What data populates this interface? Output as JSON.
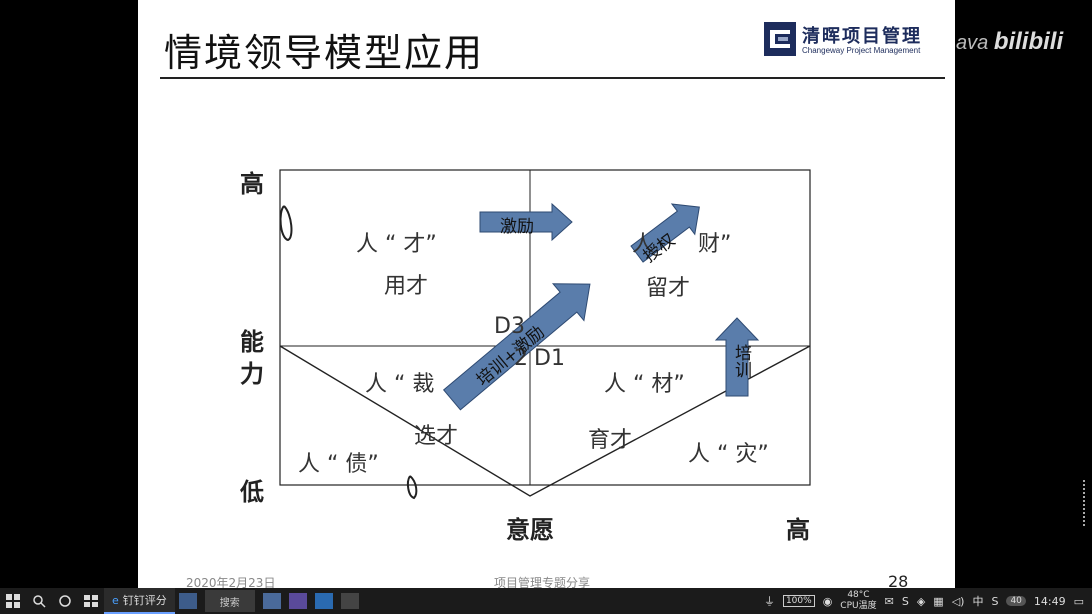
{
  "slide": {
    "title": "情境领导模型应用",
    "logo": {
      "cn": "清晖项目管理",
      "en": "Changeway Project Management"
    },
    "axes": {
      "y_high": "高",
      "y_mid_1": "能",
      "y_mid_2": "力",
      "y_low": "低",
      "x_mid": "意愿",
      "x_high": "高"
    },
    "quadrants": {
      "top_left": "人 “ 才”",
      "top_left_action": "用才",
      "top_right_a": "人",
      "top_right_b": "财”",
      "top_right_action": "留才",
      "mid_left": "人 “ 裁",
      "mid_right": "人 “ 材”",
      "bottom_left": "人 “ 债”",
      "bottom_left_action": "选才",
      "bottom_right": "人 “ 灾”",
      "bottom_right_action": "育才"
    },
    "codes": {
      "d3": "D3",
      "d2": "2",
      "d1": "D1"
    },
    "arrows": {
      "motivate": "激励",
      "empower": "授权",
      "train_motivate": "培训+激励",
      "train": "培训"
    },
    "footer": {
      "date": "2020年2月23日",
      "topic": "项目管理专题分享",
      "page": "28"
    }
  },
  "overlay": {
    "watermark_prefix": "ava",
    "watermark_brand": "bilibili"
  },
  "taskbar": {
    "app_label": "钉钉评分",
    "search_text": "搜索",
    "battery": "100%",
    "cpu_temp": "48°C",
    "cpu_label": "CPU温度",
    "ime": "中",
    "badge": "40",
    "time": "14:49"
  }
}
